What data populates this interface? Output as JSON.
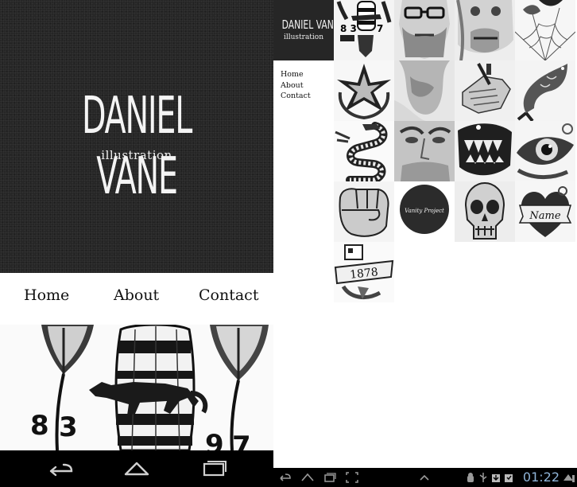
{
  "phone": {
    "hero": {
      "title": "DANIEL VANE",
      "subtitle": "illustration"
    },
    "nav": [
      {
        "label": "Home"
      },
      {
        "label": "About"
      },
      {
        "label": "Contact"
      }
    ],
    "artwork_numbers": [
      "8",
      "3",
      "9",
      "7"
    ],
    "navbar": [
      "back-icon",
      "home-icon",
      "recent-apps-icon"
    ]
  },
  "tablet": {
    "brand": {
      "title": "DANIEL VANE",
      "subtitle": "illustration"
    },
    "nav": [
      {
        "label": "Home"
      },
      {
        "label": "About"
      },
      {
        "label": "Contact"
      }
    ],
    "grid": {
      "vanity_label": "Vanity Project",
      "tiles": [
        "barrel-wolf-tattoo",
        "man-with-glasses-portrait",
        "old-man-portrait",
        "spider-web-tattoo",
        "compass-star-tattoo",
        "smoke-beard-portrait",
        "hands-lighting-cigarette",
        "koi-fish-tattoo",
        "snake-tattoo",
        "face-closeup-portrait",
        "monster-mouth-tattoo",
        "eye-tattoo",
        "fist-drawing",
        "vanity-project",
        "skull-drawing",
        "name-heart-tattoo",
        "1878-banner-tattoo"
      ],
      "banner_text": "1878",
      "heart_text": "Name"
    },
    "status_bar": {
      "time": "01:22"
    }
  },
  "colors": {
    "hero_bg": "#262626",
    "text_dark": "#111111",
    "status_time": "#8fb4d8"
  }
}
